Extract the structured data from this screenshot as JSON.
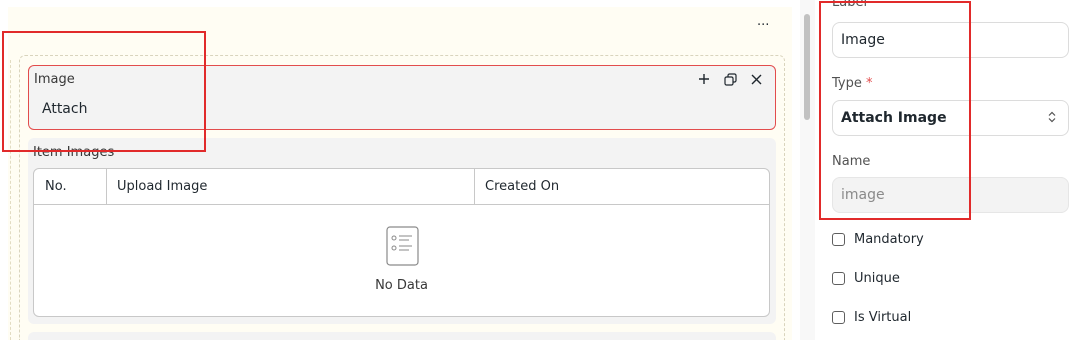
{
  "form": {
    "menu_label": "···",
    "image_field": {
      "label": "Image",
      "value": "Attach"
    },
    "table_field": {
      "label": "Item Images",
      "columns": [
        "No.",
        "Upload Image",
        "Created On"
      ],
      "empty_text": "No Data"
    }
  },
  "panel": {
    "label_field": {
      "label": "Label",
      "value": "Image"
    },
    "type_field": {
      "label": "Type",
      "required_mark": "*",
      "value": "Attach Image",
      "chevron": "⌃⌄"
    },
    "name_field": {
      "label": "Name",
      "placeholder": "image"
    },
    "checkboxes": [
      {
        "label": "Mandatory",
        "checked": false
      },
      {
        "label": "Unique",
        "checked": false
      },
      {
        "label": "Is Virtual",
        "checked": false
      }
    ]
  },
  "colors": {
    "highlight": "#e12a2a",
    "selected_border": "#e24c4c",
    "section_bg": "#fffdf3"
  }
}
